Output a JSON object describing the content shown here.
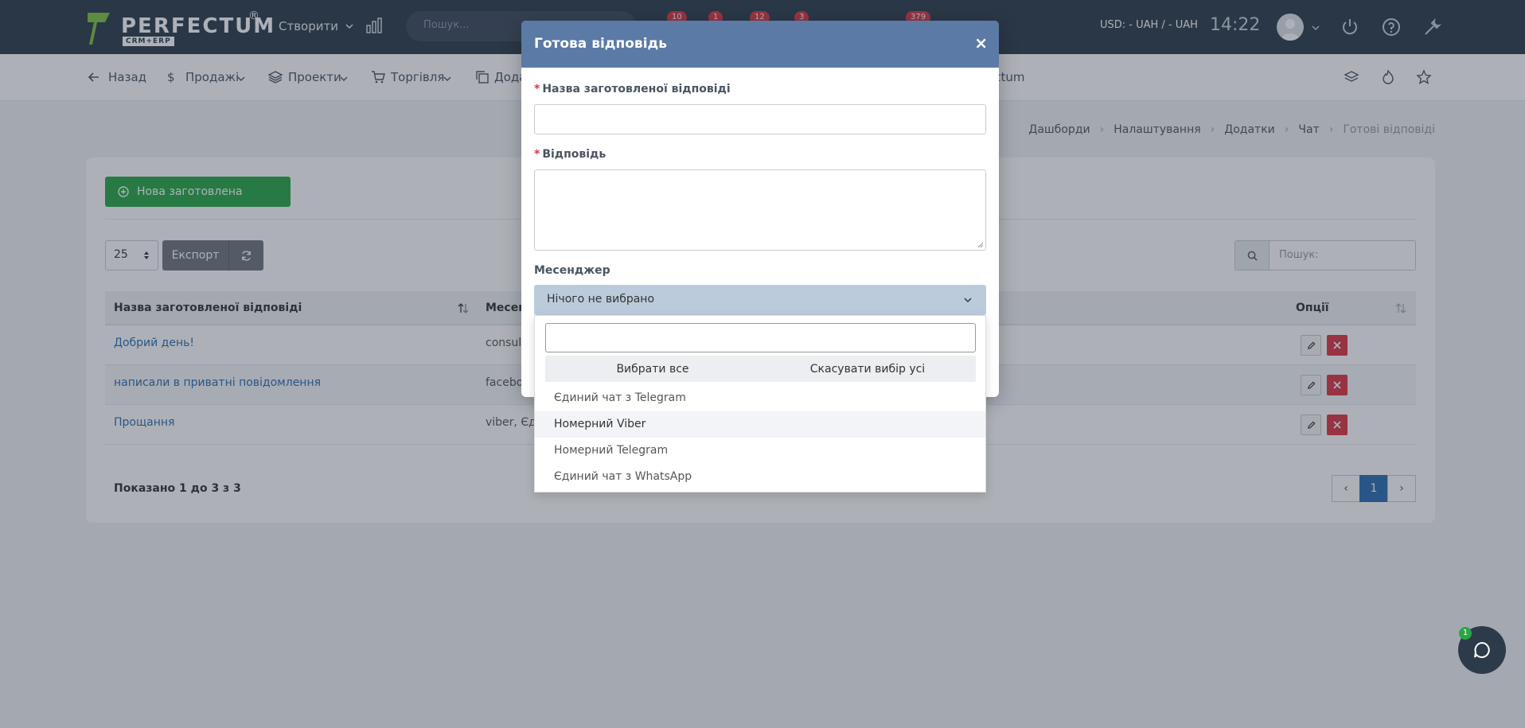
{
  "brand": {
    "name": "PERFECTUM",
    "sub": "CRM+ERP",
    "reg": "®"
  },
  "topbar": {
    "create_label": "Створити",
    "search_placeholder": "Пошук...",
    "badges": [
      "10",
      "1",
      "12",
      "3",
      "379"
    ],
    "currency": "USD: - UAH / - UAH",
    "time": "14:22"
  },
  "subnav": {
    "back": "Назад",
    "sales": "Продажі",
    "projects": "Проекти",
    "trade": "Торгівля",
    "addons": "Дода",
    "perfectum": "ectum"
  },
  "breadcrumb": [
    "Дашборди",
    "Налаштування",
    "Додатки",
    "Чат",
    "Готові відповіді"
  ],
  "page": {
    "new_button": "Нова заготовлена відповідь",
    "page_size": "25",
    "export_label": "Експорт",
    "search_placeholder": "Пошук:",
    "columns": [
      "Назва заготовленої відповіді",
      "Месен",
      "Опції"
    ],
    "rows": [
      {
        "name": "Добрий день!",
        "messenger": "consult"
      },
      {
        "name": "написали в приватні повідомлення",
        "messenger": "facebo"
      },
      {
        "name": "Прощання",
        "messenger": "viber, Єди"
      }
    ],
    "shown": "Показано 1 до 3 з 3",
    "pages": [
      "1"
    ]
  },
  "modal": {
    "title": "Готова відповідь",
    "close": "×",
    "name_label": "Назва заготовленої відповіді",
    "answer_label": "Відповідь",
    "messenger_label": "Месенджер",
    "select_value": "Нічого не вибрано",
    "required_mark": "*"
  },
  "dropdown": {
    "select_all": "Вибрати все",
    "deselect_all": "Скасувати вибір усі",
    "options": [
      "Єдиний чат з Telegram",
      "Номерний Viber",
      "Номерний Telegram",
      "Єдиний чат з WhatsApp"
    ]
  },
  "chat": {
    "badge": "1"
  }
}
